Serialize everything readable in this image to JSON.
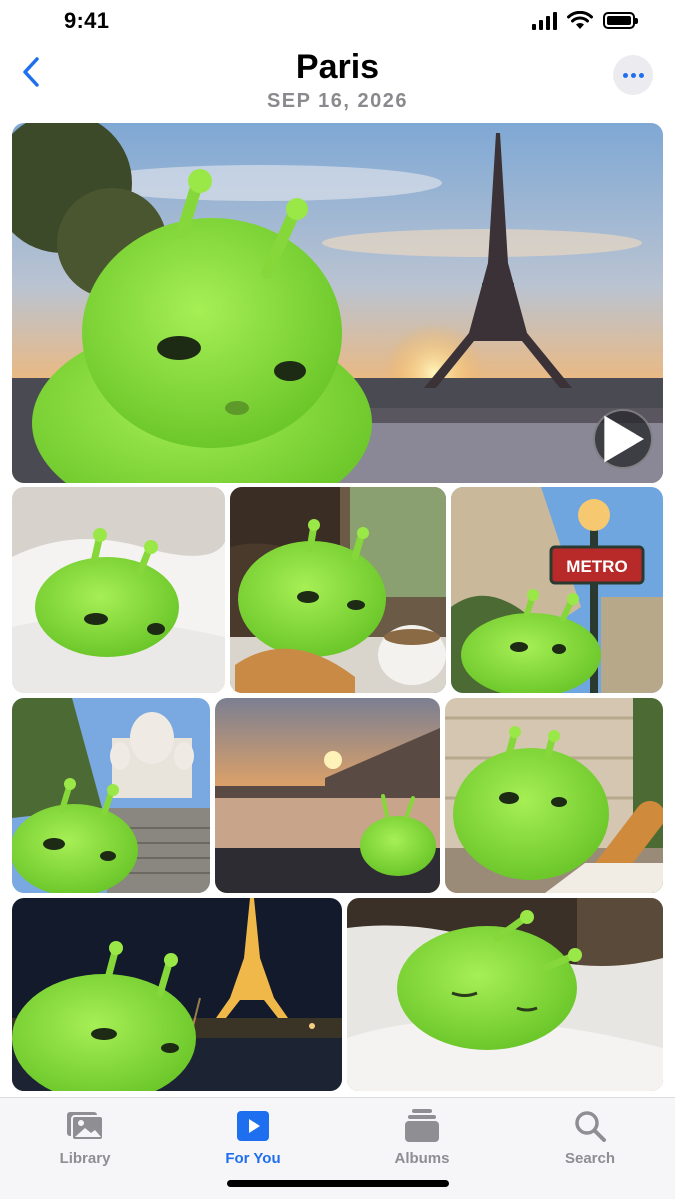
{
  "status": {
    "time": "9:41"
  },
  "header": {
    "title": "Paris",
    "date": "SEP 16, 2026"
  },
  "photos": [
    {
      "name": "eiffel-sunset-video",
      "is_video": true
    },
    {
      "name": "bed-morning"
    },
    {
      "name": "cafe-croissant"
    },
    {
      "name": "metro-sign",
      "sign_text": "METRO"
    },
    {
      "name": "sacre-coeur"
    },
    {
      "name": "seine-sunset"
    },
    {
      "name": "baguette-street"
    },
    {
      "name": "eiffel-night"
    },
    {
      "name": "sleeping-bed"
    }
  ],
  "tabs": [
    {
      "label": "Library",
      "icon": "photo-library-icon",
      "active": false
    },
    {
      "label": "For You",
      "icon": "for-you-play-icon",
      "active": true
    },
    {
      "label": "Albums",
      "icon": "albums-stack-icon",
      "active": false
    },
    {
      "label": "Search",
      "icon": "magnifier-icon",
      "active": false
    }
  ],
  "colors": {
    "accent": "#1e6ff0",
    "inactive": "#8e8e93",
    "creature": "#8fe33c"
  }
}
